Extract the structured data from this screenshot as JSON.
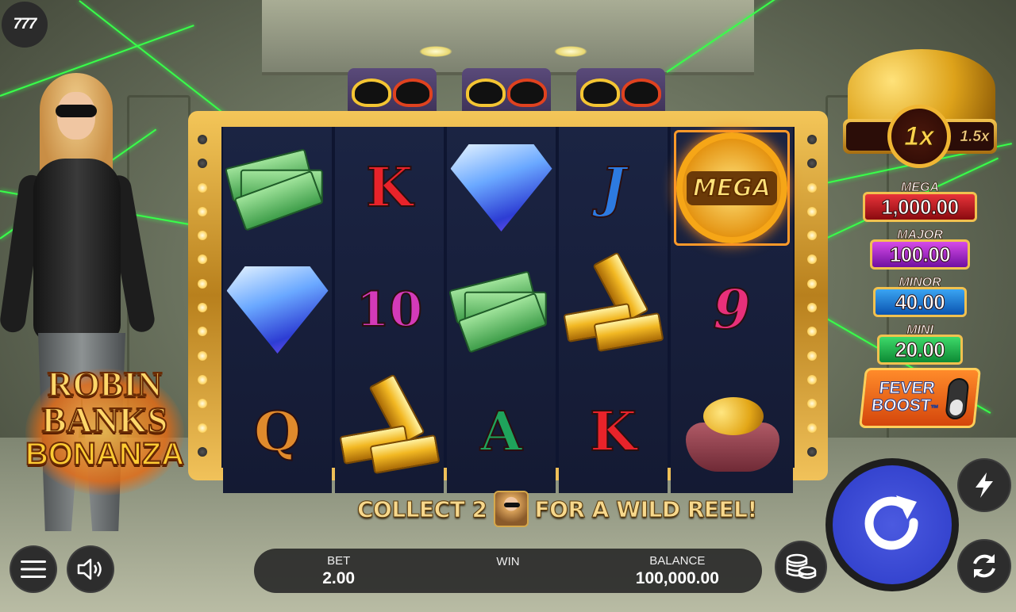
{
  "corner_logo": "777",
  "game_logo": {
    "line1": "ROBIN",
    "line2": "BANKS",
    "line3": "BONANZA",
    "trademark": "™"
  },
  "reels": [
    [
      "money",
      "diamond",
      "Q"
    ],
    [
      "K",
      "10",
      "gold"
    ],
    [
      "diamond",
      "money",
      "A"
    ],
    [
      "J",
      "gold",
      "K"
    ],
    [
      "mega",
      "9",
      "purse"
    ]
  ],
  "mega_symbol_label": "MEGA",
  "collect_text": {
    "before": "COLLECT 2",
    "after": "FOR A WILD REEL!"
  },
  "multiplier": {
    "current": "1x",
    "next": "1.5x"
  },
  "jackpots": [
    {
      "name": "MEGA",
      "value": "1,000.00",
      "color": "#e8333a"
    },
    {
      "name": "MAJOR",
      "value": "100.00",
      "color": "#d64ae8"
    },
    {
      "name": "MINOR",
      "value": "40.00",
      "color": "#3aa4f2"
    },
    {
      "name": "MINI",
      "value": "20.00",
      "color": "#3ed96a"
    }
  ],
  "fever_boost": {
    "line1": "FEVER",
    "line2": "BOOST",
    "trademark": "™"
  },
  "bet": {
    "label": "BET",
    "value": "2.00"
  },
  "win": {
    "label": "WIN",
    "value": ""
  },
  "balance": {
    "label": "BALANCE",
    "value": "100,000.00"
  },
  "icons": {
    "menu": "hamburger-icon",
    "sound": "speaker-icon",
    "bet_settings": "coin-stack-icon",
    "spin": "refresh-arrow-icon",
    "turbo": "lightning-icon",
    "autoplay": "autoplay-arrows-icon"
  },
  "colors": {
    "spin_button": "#2c3bc8",
    "laser": "#38ff4a",
    "frame_gold": "#f4c659"
  }
}
